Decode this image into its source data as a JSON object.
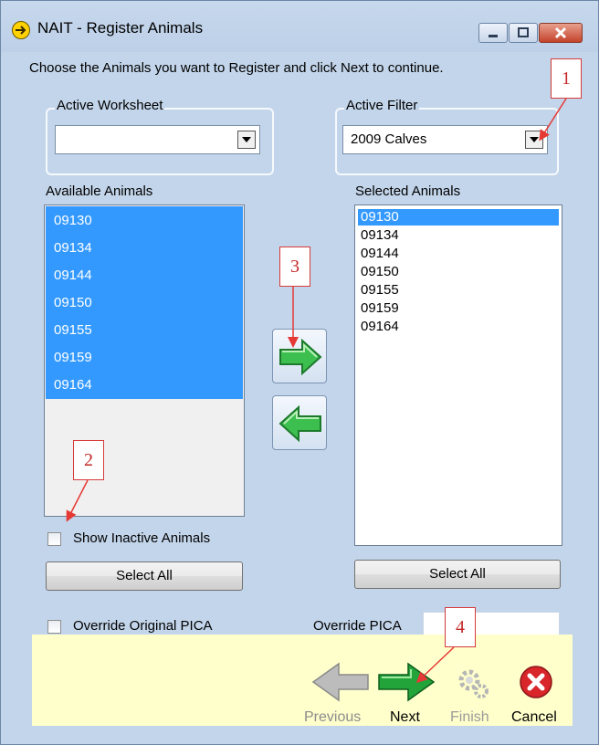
{
  "window": {
    "title": "NAIT - Register Animals",
    "instruction": "Choose the Animals you want to Register and click Next to continue."
  },
  "active_worksheet": {
    "label": "Active Worksheet",
    "value": ""
  },
  "active_filter": {
    "label": "Active Filter",
    "value": "2009 Calves"
  },
  "available": {
    "label": "Available Animals",
    "items": [
      "09130",
      "09134",
      "09144",
      "09150",
      "09155",
      "09159",
      "09164"
    ]
  },
  "selected": {
    "label": "Selected Animals",
    "items": [
      "09130",
      "09134",
      "09144",
      "09150",
      "09155",
      "09159",
      "09164"
    ]
  },
  "show_inactive": {
    "label": "Show Inactive Animals",
    "checked": false
  },
  "select_all_left": "Select All",
  "select_all_right": "Select All",
  "override_original": {
    "label": "Override Original PICA",
    "checked": false
  },
  "override_pica": {
    "label": "Override PICA",
    "value": ""
  },
  "nav": {
    "previous": "Previous",
    "next": "Next",
    "finish": "Finish",
    "cancel": "Cancel"
  },
  "callouts": [
    "1",
    "2",
    "3",
    "4"
  ],
  "colors": {
    "window_bg": "#c3d5ea",
    "selection": "#3399ff",
    "footer_bg": "#ffffcc",
    "callout_red": "#c62828",
    "arrow_green": "#22a43a"
  }
}
